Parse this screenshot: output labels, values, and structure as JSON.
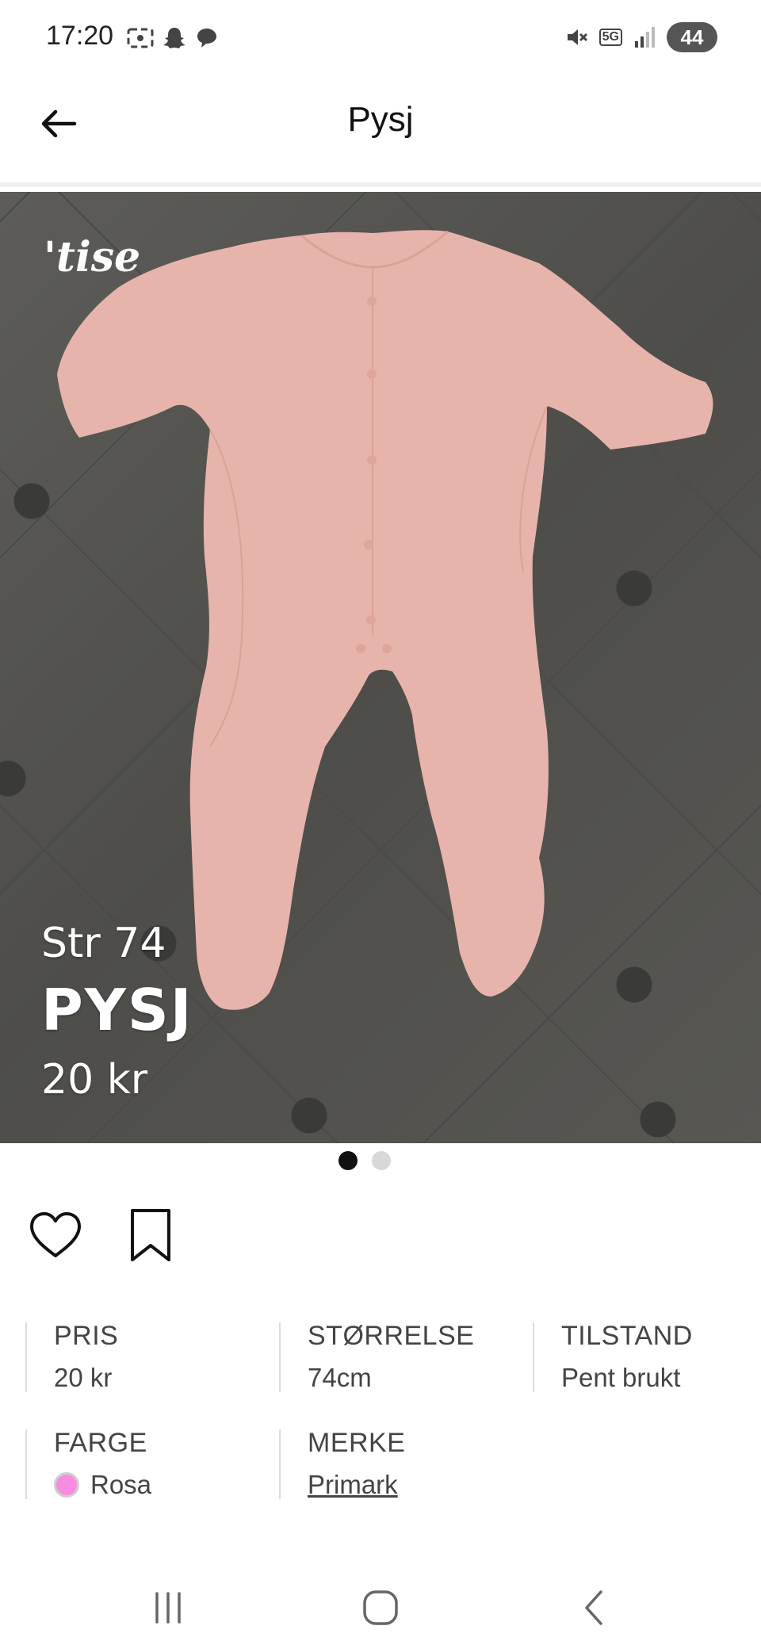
{
  "status_bar": {
    "time": "17:20",
    "network": "5G",
    "battery": "44",
    "icons_left": [
      "screenshot-icon",
      "snapchat-icon",
      "chat-icon"
    ],
    "icons_right": [
      "mute-icon",
      "5g-icon",
      "signal-icon",
      "battery-icon"
    ]
  },
  "header": {
    "title": "Pysj",
    "back_icon": "arrow-left-icon"
  },
  "image": {
    "logo_text": "tise",
    "overlay_size": "Str 74",
    "overlay_title": "PYSJ",
    "overlay_price": "20 kr",
    "page_count": 2,
    "current_page": 1
  },
  "actions": {
    "like_icon": "heart-icon",
    "save_icon": "bookmark-icon"
  },
  "attributes": {
    "price": {
      "label": "PRIS",
      "value": "20 kr"
    },
    "size": {
      "label": "STØRRELSE",
      "value": "74cm"
    },
    "condition": {
      "label": "TILSTAND",
      "value": "Pent brukt"
    },
    "color": {
      "label": "FARGE",
      "value": "Rosa",
      "swatch": "#f78de0"
    },
    "brand": {
      "label": "MERKE",
      "value": "Primark"
    }
  },
  "colors": {
    "garment": "#e9b9b1",
    "background": "#55544f",
    "dot_active": "#111111",
    "dot_inactive": "#d8d8d8"
  },
  "nav_bar": {
    "icons": [
      "recent-apps-icon",
      "home-icon",
      "back-icon"
    ]
  }
}
